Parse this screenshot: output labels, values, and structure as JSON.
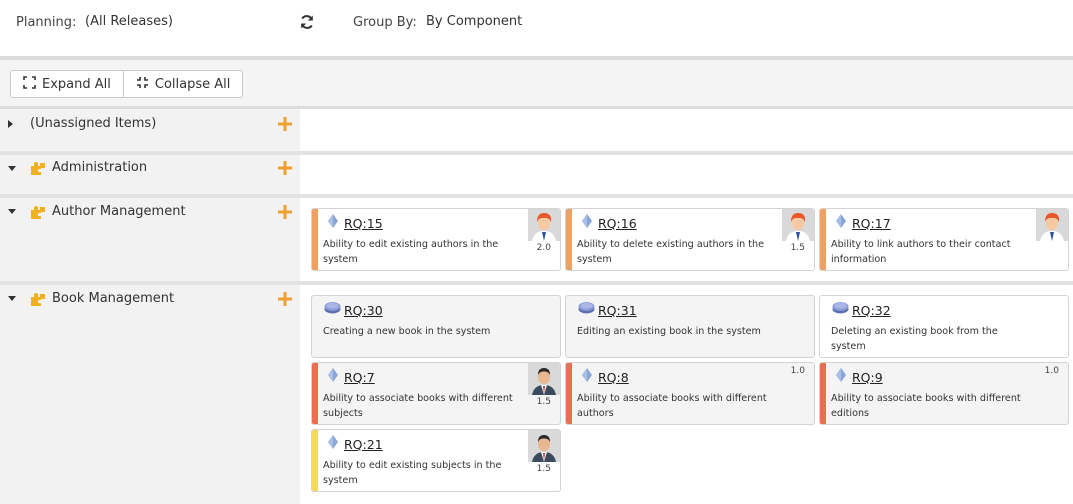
{
  "topbar": {
    "planning_label": "Planning:",
    "planning_value": "(All Releases)",
    "refresh_icon": "refresh-icon",
    "groupby_label": "Group By:",
    "groupby_value": "By Component"
  },
  "toolbar": {
    "expand_label": "Expand All",
    "collapse_label": "Collapse All"
  },
  "colors": {
    "accent_orange": "#f0a030",
    "bar_orange": "#f0a060",
    "bar_red": "#e87050",
    "bar_yellow": "#f5d95a",
    "feature_icon": "#8aa6d6"
  },
  "groups": [
    {
      "name": "(Unassigned Items)",
      "expanded": false,
      "icon": ""
    },
    {
      "name": "Administration",
      "expanded": true,
      "icon": "component-icon"
    },
    {
      "name": "Author Management",
      "expanded": true,
      "icon": "component-icon"
    },
    {
      "name": "Book Management",
      "expanded": true,
      "icon": "component-icon"
    }
  ],
  "cards": [
    {
      "id": "RQ:15",
      "desc": "Ability to edit existing authors in the system",
      "estimate": "2.0",
      "type": "requirement",
      "bar": "orange",
      "avatar": "red-hair-avatar"
    },
    {
      "id": "RQ:16",
      "desc": "Ability to delete existing authors in the system",
      "estimate": "1.5",
      "type": "requirement",
      "bar": "orange",
      "avatar": "red-hair-avatar"
    },
    {
      "id": "RQ:17",
      "desc": "Ability to link authors to their contact information",
      "estimate": "",
      "type": "requirement",
      "bar": "orange",
      "avatar": "red-hair-avatar"
    },
    {
      "id": "RQ:30",
      "desc": "Creating a new book in the system",
      "estimate": "",
      "type": "epic",
      "bar": "",
      "avatar": ""
    },
    {
      "id": "RQ:31",
      "desc": "Editing an existing book in the system",
      "estimate": "",
      "type": "epic",
      "bar": "",
      "avatar": ""
    },
    {
      "id": "RQ:32",
      "desc": "Deleting an existing book from the system",
      "estimate": "",
      "type": "epic",
      "bar": "",
      "avatar": ""
    },
    {
      "id": "RQ:7",
      "desc": "Ability to associate books with different subjects",
      "estimate": "1.5",
      "type": "requirement",
      "bar": "red",
      "avatar": "suit-avatar"
    },
    {
      "id": "RQ:8",
      "desc": "Ability to associate books with different authors",
      "estimate": "1.0",
      "type": "requirement",
      "bar": "red",
      "avatar": ""
    },
    {
      "id": "RQ:9",
      "desc": "Ability to associate books with different editions",
      "estimate": "1.0",
      "type": "requirement",
      "bar": "red",
      "avatar": ""
    },
    {
      "id": "RQ:21",
      "desc": "Ability to edit existing subjects in the system",
      "estimate": "1.5",
      "type": "requirement",
      "bar": "yellow",
      "avatar": "suit-avatar"
    }
  ]
}
